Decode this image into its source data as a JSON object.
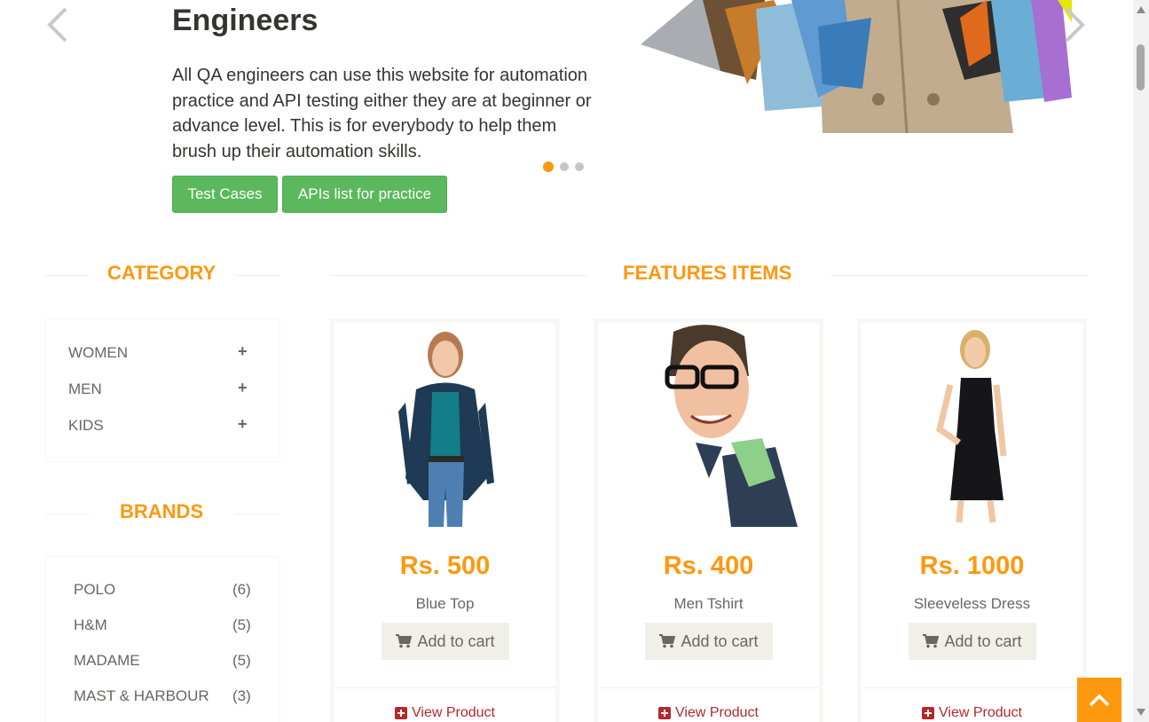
{
  "slider": {
    "title": "Engineers",
    "text": "All QA engineers can use this website for automation practice and API testing either they are at beginner or advance level. This is for everybody to help them brush up their automation skills.",
    "buttons": {
      "test_cases": "Test Cases",
      "apis": "APIs list for practice"
    },
    "dots_count": 3,
    "active_dot": 1
  },
  "category": {
    "title": "Category",
    "items": [
      {
        "label": "WOMEN"
      },
      {
        "label": "MEN"
      },
      {
        "label": "KIDS"
      }
    ]
  },
  "brands": {
    "title": "Brands",
    "items": [
      {
        "name": "POLO",
        "count": "(6)"
      },
      {
        "name": "H&M",
        "count": "(5)"
      },
      {
        "name": "MADAME",
        "count": "(5)"
      },
      {
        "name": "MAST & HARBOUR",
        "count": "(3)"
      }
    ]
  },
  "features": {
    "title": "Features Items",
    "products": [
      {
        "price": "Rs. 500",
        "name": "Blue Top",
        "add_label": "Add to cart",
        "view_label": "View Product"
      },
      {
        "price": "Rs. 400",
        "name": "Men Tshirt",
        "add_label": "Add to cart",
        "view_label": "View Product"
      },
      {
        "price": "Rs. 1000",
        "name": "Sleeveless Dress",
        "add_label": "Add to cart",
        "view_label": "View Product"
      }
    ]
  },
  "colors": {
    "accent": "#fe980f",
    "button_green": "#5cb85c",
    "link_red": "#b3292d",
    "text_gray": "#696763"
  }
}
